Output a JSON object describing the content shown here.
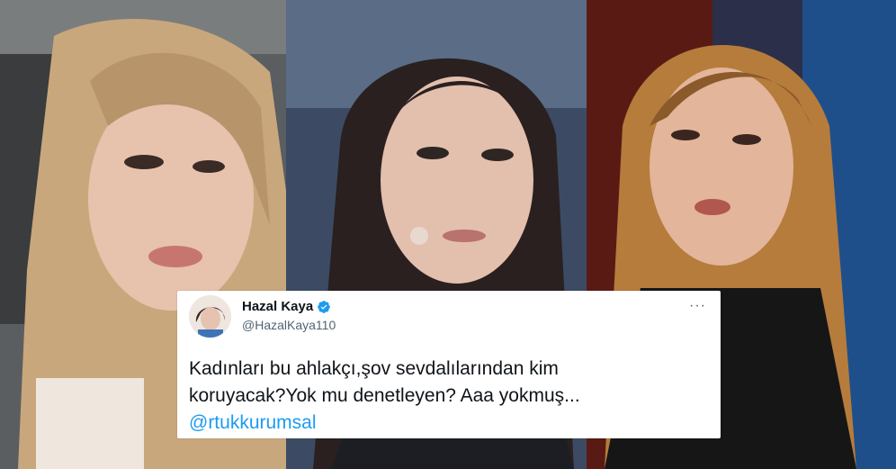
{
  "photos": [
    {
      "name": "left-portrait"
    },
    {
      "name": "middle-portrait"
    },
    {
      "name": "right-portrait"
    }
  ],
  "tweet": {
    "display_name": "Hazal Kaya",
    "handle": "@HazalKaya110",
    "more_icon": "more-horizontal-icon",
    "verified_icon": "verified-badge-icon",
    "text_line1": "Kadınları bu ahlakçı,şov sevdalılarından kim",
    "text_line2": "koruyacak?Yok mu denetleyen? Aaa yokmuş...",
    "mention": "@rtukkurumsal",
    "more_label": "···"
  },
  "colors": {
    "verified": "#1d9bf0",
    "mention": "#1d9bf0",
    "text": "#0f1419",
    "muted": "#536471"
  }
}
